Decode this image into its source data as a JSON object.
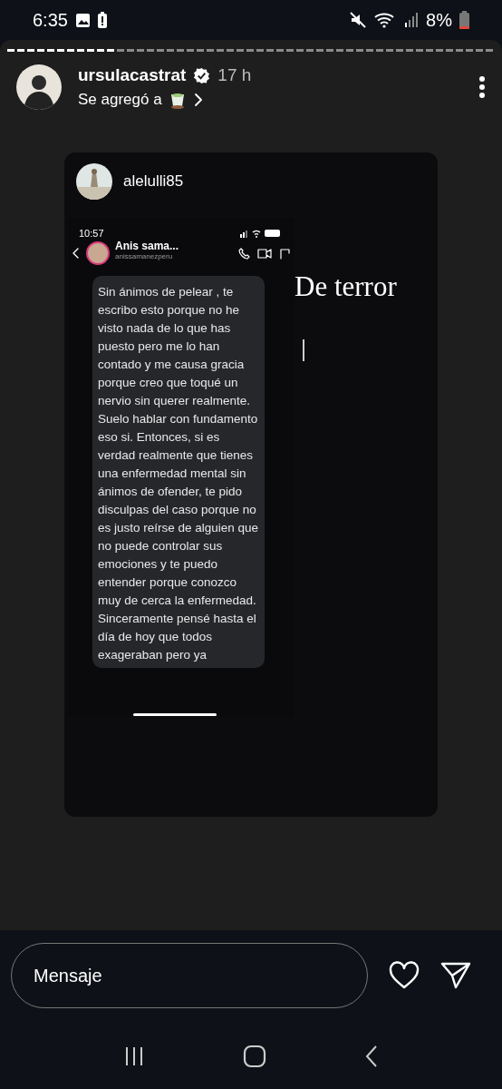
{
  "status_bar": {
    "time": "6:35",
    "battery": "8%"
  },
  "story": {
    "progress": {
      "level": 0.22
    },
    "username": "ursulacastrat",
    "verified": true,
    "time": "17 h",
    "subtitle": "Se agregó a"
  },
  "shared_post": {
    "username": "alelulli85",
    "screenshot": {
      "time": "10:57",
      "contact_name": "Anis sama...",
      "contact_handle": "anissamanezperu",
      "message": [
        "Sin ánimos de pelear , te escribo esto porque no he visto nada de lo que has puesto pero me lo han contado y me causa gracia porque creo que toqué un nervio sin querer realmente. Suelo hablar con fundamento eso si. Entonces, si es verdad realmente que tienes una enfermedad mental sin ánimos de ofender, te pido disculpas del caso porque no es justo reírse de alguien que no puede controlar sus emociones y te puedo entender porque conozco muy de cerca la enfermedad.",
        "Sinceramente pensé hasta el día de hoy que todos exageraban pero ya"
      ]
    },
    "caption": "De terror"
  },
  "reply": {
    "placeholder": "Mensaje"
  }
}
